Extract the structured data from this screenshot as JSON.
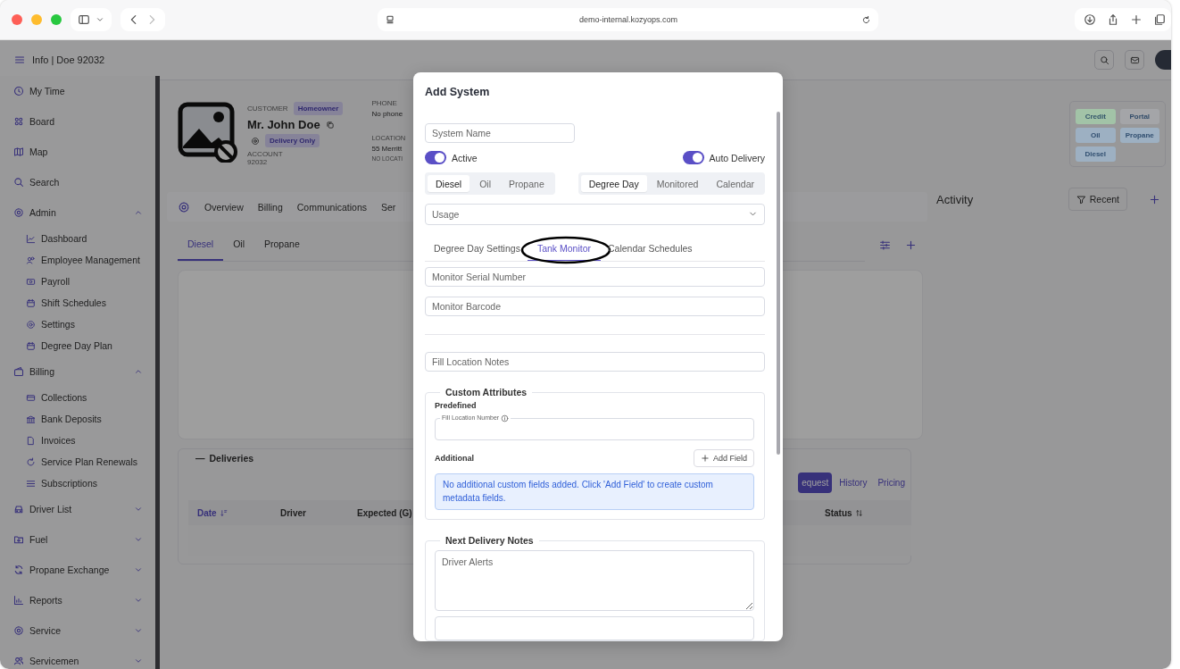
{
  "browser": {
    "url": "demo-internal.kozyops.com"
  },
  "header": {
    "title": "Info | Doe 92032"
  },
  "sidebar": {
    "items": [
      {
        "kind": "link",
        "label": "My Time"
      },
      {
        "kind": "link",
        "label": "Board"
      },
      {
        "kind": "link",
        "label": "Map"
      },
      {
        "kind": "link",
        "label": "Search"
      },
      {
        "kind": "group",
        "label": "Admin",
        "expanded": true,
        "children": [
          {
            "label": "Dashboard"
          },
          {
            "label": "Employee Management"
          },
          {
            "label": "Payroll"
          },
          {
            "label": "Shift Schedules"
          },
          {
            "label": "Settings"
          },
          {
            "label": "Degree Day Plan"
          }
        ]
      },
      {
        "kind": "group",
        "label": "Billing",
        "expanded": true,
        "children": [
          {
            "label": "Collections"
          },
          {
            "label": "Bank Deposits"
          },
          {
            "label": "Invoices"
          },
          {
            "label": "Service Plan Renewals"
          },
          {
            "label": "Subscriptions"
          }
        ]
      },
      {
        "kind": "group",
        "label": "Driver List",
        "expanded": false
      },
      {
        "kind": "group",
        "label": "Fuel",
        "expanded": false
      },
      {
        "kind": "group",
        "label": "Propane Exchange",
        "expanded": false
      },
      {
        "kind": "group",
        "label": "Reports",
        "expanded": false
      },
      {
        "kind": "group",
        "label": "Service",
        "expanded": false
      },
      {
        "kind": "group",
        "label": "Servicemen",
        "expanded": false
      }
    ]
  },
  "customer": {
    "customer_label": "CUSTOMER",
    "type_badge": "Homeowner",
    "name": "Mr. John Doe",
    "service_badge": "Delivery Only",
    "account_label": "ACCOUNT",
    "account": "92032",
    "phone_label": "PHONE",
    "phone": "No phone",
    "location_label": "LOCATION",
    "location": "55 Merritt",
    "location_note": "NO LOCATI"
  },
  "tags": [
    {
      "label": "Credit",
      "color": "#a2c3a7"
    },
    {
      "label": "Portal",
      "color": "#a4a5a8"
    },
    {
      "label": "Oil",
      "color": "#9db0c2"
    },
    {
      "label": "Propane",
      "color": "#9db0c2"
    },
    {
      "label": "Diesel",
      "color": "#9db0c2"
    }
  ],
  "tabs": [
    {
      "label": "Overview"
    },
    {
      "label": "Billing"
    },
    {
      "label": "Communications"
    },
    {
      "label": "Ser"
    }
  ],
  "systems": {
    "tabs": [
      {
        "label": "Diesel",
        "selected": true
      },
      {
        "label": "Oil",
        "selected": false
      },
      {
        "label": "Propane",
        "selected": false
      }
    ]
  },
  "deliveries": {
    "collapse_symbol": "—",
    "title": "Deliveries",
    "buttons": [
      {
        "label": "equest",
        "selected": true
      },
      {
        "label": "History",
        "selected": false
      },
      {
        "label": "Pricing",
        "selected": false
      }
    ],
    "columns": [
      "Date",
      "Driver",
      "Expected (G)",
      "Status"
    ]
  },
  "activity": {
    "title": "Activity",
    "filter": "Recent"
  },
  "modal": {
    "title": "Add System",
    "system_name": {
      "placeholder": "System Name"
    },
    "toggles": [
      {
        "label": "Active",
        "on": true
      },
      {
        "label": "Auto Delivery",
        "on": true
      }
    ],
    "fuel_tabs": [
      {
        "label": "Diesel",
        "selected": true
      },
      {
        "label": "Oil",
        "selected": false
      },
      {
        "label": "Propane",
        "selected": false
      }
    ],
    "mode_tabs": [
      {
        "label": "Degree Day",
        "selected": true
      },
      {
        "label": "Monitored",
        "selected": false
      },
      {
        "label": "Calendar",
        "selected": false
      }
    ],
    "usage": {
      "placeholder": "Usage"
    },
    "section_tabs": [
      {
        "label": "Degree Day Settings",
        "selected": false
      },
      {
        "label": "Tank Monitor",
        "selected": true
      },
      {
        "label": "Calendar Schedules",
        "selected": false
      }
    ],
    "monitor_fields": [
      {
        "placeholder": "Monitor Serial Number"
      },
      {
        "placeholder": "Monitor Barcode"
      }
    ],
    "fill_location_notes": {
      "placeholder": "Fill Location Notes"
    },
    "custom_attributes": {
      "title": "Custom Attributes",
      "predefined_label": "Predefined",
      "predefined_fields": [
        {
          "label": "Fill Location Number"
        }
      ],
      "additional_label": "Additional",
      "add_button": "Add Field",
      "empty_message": "No additional custom fields added. Click 'Add Field' to create custom metadata fields."
    },
    "next_delivery_notes": {
      "title": "Next Delivery Notes",
      "fields": [
        {
          "placeholder": "Driver Alerts"
        }
      ]
    }
  }
}
